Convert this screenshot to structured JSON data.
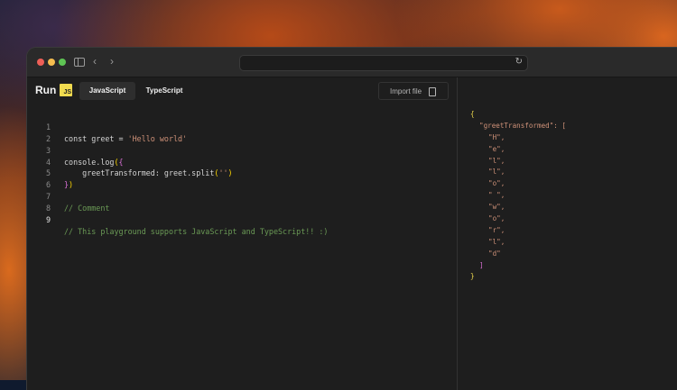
{
  "toolbar": {
    "run_label": "Run",
    "js_badge": "JS",
    "tabs": [
      {
        "label": "JavaScript",
        "active": true
      },
      {
        "label": "TypeScript",
        "active": false
      }
    ],
    "import_label": "Import file"
  },
  "editor": {
    "active_line": 9,
    "lines": [
      {
        "number": "1",
        "text": "const greet = 'Hello world'"
      },
      {
        "number": "2",
        "text": ""
      },
      {
        "number": "3",
        "text": "console.log({"
      },
      {
        "number": "4",
        "text": "    greetTransformed: greet.split('')"
      },
      {
        "number": "5",
        "text": "})"
      },
      {
        "number": "6",
        "text": ""
      },
      {
        "number": "7",
        "text": "// Comment"
      },
      {
        "number": "8",
        "text": ""
      },
      {
        "number": "9",
        "text": "// This playground supports JavaScript and TypeScript!! :)"
      }
    ]
  },
  "output": {
    "open_brace": "{",
    "key": "\"greetTransformed\": [",
    "items": [
      "\"H\",",
      "\"e\",",
      "\"l\",",
      "\"l\",",
      "\"o\",",
      "\" \",",
      "\"w\",",
      "\"o\",",
      "\"r\",",
      "\"l\",",
      "\"d\""
    ],
    "close_bracket": "]",
    "close_brace": "}"
  },
  "colors": {
    "js_badge": "#f0db4f",
    "comment": "#6a9955",
    "string": "#ce9178",
    "background": "#1e1e1e"
  },
  "icons": [
    "sidebar-toggle-icon",
    "chevron-left-icon",
    "chevron-right-icon",
    "reload-icon",
    "file-icon"
  ]
}
